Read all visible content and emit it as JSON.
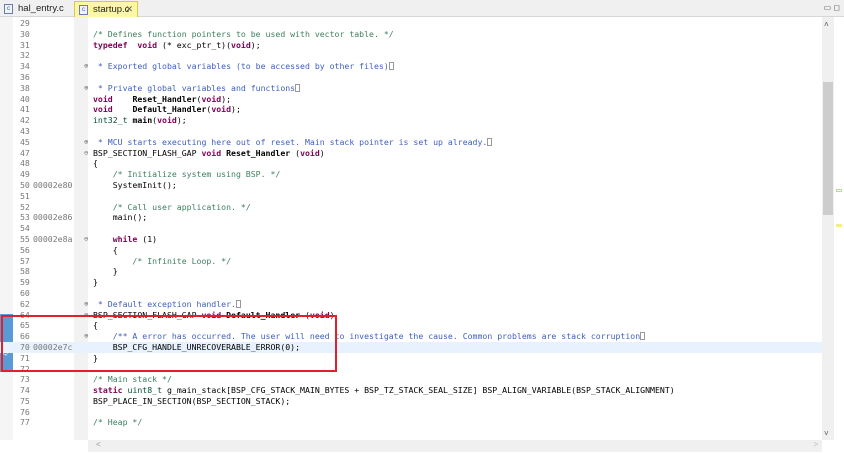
{
  "tabs": [
    {
      "label": "hal_entry.c",
      "icon": "c-file-icon",
      "active": false
    },
    {
      "label": "startup.c",
      "icon": "c-file-icon",
      "active": true,
      "close": "✕"
    }
  ],
  "colors": {
    "keyword": "#7f0055",
    "comment": "#3f7f5f",
    "javadoc": "#3f5fbf",
    "current_line": "#e8f2fe",
    "highlight": "#c6dfa2",
    "annotation_box": "#e0202a"
  },
  "lines": [
    {
      "num": "29",
      "addr": "",
      "fold": "",
      "t": []
    },
    {
      "num": "30",
      "addr": "",
      "fold": "",
      "t": [
        [
          "cm",
          "/* Defines function pointers to be used with vector table. */"
        ]
      ]
    },
    {
      "num": "31",
      "addr": "",
      "fold": "",
      "t": [
        [
          "kw",
          "typedef"
        ],
        [
          "",
          "  "
        ],
        [
          "kw",
          "void"
        ],
        [
          "",
          " (* exc_ptr_t)("
        ],
        [
          "kw",
          "void"
        ],
        [
          "",
          ");"
        ]
      ]
    },
    {
      "num": "32",
      "addr": "",
      "fold": "",
      "t": []
    },
    {
      "num": "34",
      "addr": "",
      "fold": "⊕",
      "t": [
        [
          "jd",
          " * Exported global variables (to be accessed by other files)"
        ],
        [
          "box",
          ""
        ]
      ]
    },
    {
      "num": "36",
      "addr": "",
      "fold": "",
      "t": []
    },
    {
      "num": "38",
      "addr": "",
      "fold": "⊕",
      "t": [
        [
          "jd",
          " * Private global variables and functions"
        ],
        [
          "box",
          ""
        ]
      ]
    },
    {
      "num": "40",
      "addr": "",
      "fold": "",
      "t": [
        [
          "kw",
          "void"
        ],
        [
          "",
          "    "
        ],
        [
          "fn",
          "Reset_Handler"
        ],
        [
          "",
          "("
        ],
        [
          "kw",
          "void"
        ],
        [
          "",
          ");"
        ]
      ]
    },
    {
      "num": "41",
      "addr": "",
      "fold": "",
      "t": [
        [
          "kw",
          "void"
        ],
        [
          "",
          "    "
        ],
        [
          "fn",
          "Default_Handler"
        ],
        [
          "",
          "("
        ],
        [
          "kw",
          "void"
        ],
        [
          "",
          ");"
        ]
      ]
    },
    {
      "num": "42",
      "addr": "",
      "fold": "",
      "t": [
        [
          "ty",
          "int32_t"
        ],
        [
          "",
          " "
        ],
        [
          "fn",
          "main"
        ],
        [
          "",
          "("
        ],
        [
          "kw",
          "void"
        ],
        [
          "",
          ");"
        ]
      ]
    },
    {
      "num": "43",
      "addr": "",
      "fold": "",
      "t": []
    },
    {
      "num": "45",
      "addr": "",
      "fold": "⊕",
      "t": [
        [
          "jd",
          " * MCU starts executing here out of reset. Main stack pointer is set up already."
        ],
        [
          "box",
          ""
        ]
      ]
    },
    {
      "num": "47",
      "addr": "",
      "fold": "⊖",
      "t": [
        [
          "",
          "BSP_SECTION_FLASH_GAP "
        ],
        [
          "kw",
          "void"
        ],
        [
          "",
          " "
        ],
        [
          "fn",
          "Reset_Handler"
        ],
        [
          "",
          " ("
        ],
        [
          "kw",
          "void"
        ],
        [
          "",
          ")"
        ]
      ]
    },
    {
      "num": "48",
      "addr": "",
      "fold": "",
      "t": [
        [
          "",
          "{"
        ]
      ]
    },
    {
      "num": "49",
      "addr": "",
      "fold": "",
      "t": [
        [
          "cm",
          "    /* Initialize system using BSP. */"
        ]
      ]
    },
    {
      "num": "50",
      "addr": "00002e80",
      "fold": "",
      "t": [
        [
          "",
          "    SystemInit();"
        ]
      ]
    },
    {
      "num": "51",
      "addr": "",
      "fold": "",
      "t": []
    },
    {
      "num": "52",
      "addr": "",
      "fold": "",
      "t": [
        [
          "cm",
          "    /* Call user application. */"
        ]
      ]
    },
    {
      "num": "53",
      "addr": "00002e86",
      "fold": "",
      "t": [
        [
          "",
          "    main();"
        ]
      ]
    },
    {
      "num": "54",
      "addr": "",
      "fold": "",
      "t": []
    },
    {
      "num": "55",
      "addr": "00002e8a",
      "fold": "⊖",
      "t": [
        [
          "",
          "    "
        ],
        [
          "kw",
          "while"
        ],
        [
          "",
          " (1)"
        ]
      ]
    },
    {
      "num": "56",
      "addr": "",
      "fold": "",
      "t": [
        [
          "",
          "    {"
        ]
      ]
    },
    {
      "num": "57",
      "addr": "",
      "fold": "",
      "t": [
        [
          "cm",
          "        /* Infinite Loop. */"
        ]
      ]
    },
    {
      "num": "58",
      "addr": "",
      "fold": "",
      "t": [
        [
          "",
          "    }"
        ]
      ]
    },
    {
      "num": "59",
      "addr": "",
      "fold": "",
      "t": [
        [
          "",
          "}"
        ]
      ]
    },
    {
      "num": "60",
      "addr": "",
      "fold": "",
      "t": []
    },
    {
      "num": "62",
      "addr": "",
      "fold": "⊕",
      "t": [
        [
          "jd",
          " * Default exception handler."
        ],
        [
          "box",
          ""
        ]
      ]
    },
    {
      "num": "64",
      "addr": "",
      "fold": "⊖",
      "t": [
        [
          "",
          "BSP_SECTION_FLASH_GAP "
        ],
        [
          "kw",
          "void"
        ],
        [
          "",
          " "
        ],
        [
          "fn",
          "Default_Handler"
        ],
        [
          "",
          " ("
        ],
        [
          "kw",
          "void"
        ],
        [
          "",
          ")"
        ]
      ]
    },
    {
      "num": "65",
      "addr": "",
      "fold": "",
      "t": [
        [
          "",
          "{"
        ]
      ]
    },
    {
      "num": "66",
      "addr": "",
      "fold": "⊕",
      "t": [
        [
          "jd",
          "    /** A error has occurred. The user will need to investigate the cause. Common problems are stack corruption"
        ],
        [
          "box",
          ""
        ]
      ]
    },
    {
      "num": "70",
      "addr": "00002e7c",
      "fold": "",
      "current": true,
      "t": [
        [
          "hl",
          "    BSP_CFG_HANDLE_UNRECOVERABLE_ERROR(0);"
        ]
      ]
    },
    {
      "num": "71",
      "addr": "",
      "fold": "",
      "t": [
        [
          "",
          "}"
        ]
      ]
    },
    {
      "num": "72",
      "addr": "",
      "fold": "",
      "t": []
    },
    {
      "num": "73",
      "addr": "",
      "fold": "",
      "t": [
        [
          "cm",
          "/* Main stack */"
        ]
      ]
    },
    {
      "num": "74",
      "addr": "",
      "fold": "",
      "t": [
        [
          "kw",
          "static"
        ],
        [
          "",
          " "
        ],
        [
          "ty",
          "uint8_t"
        ],
        [
          "",
          " g_main_stack[BSP_CFG_STACK_MAIN_BYTES + BSP_TZ_STACK_SEAL_SIZE] BSP_ALIGN_VARIABLE(BSP_STACK_ALIGNMENT)"
        ]
      ]
    },
    {
      "num": "75",
      "addr": "",
      "fold": "",
      "t": [
        [
          "",
          "BSP_PLACE_IN_SECTION(BSP_SECTION_STACK);"
        ]
      ]
    },
    {
      "num": "76",
      "addr": "",
      "fold": "",
      "t": []
    },
    {
      "num": "77",
      "addr": "",
      "fold": "",
      "t": [
        [
          "cm",
          "/* Heap */"
        ]
      ]
    }
  ]
}
